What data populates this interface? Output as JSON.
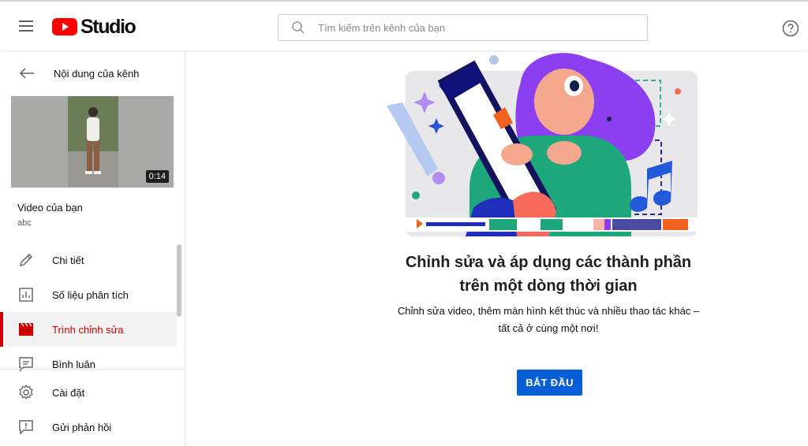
{
  "header": {
    "logo_text": "Studio",
    "search_placeholder": "Tìm kiếm trên kênh của bạn",
    "brand_color": "#ff0000"
  },
  "sidebar": {
    "back_label": "Nội dung của kênh",
    "video": {
      "duration": "0:14",
      "title": "Video của bạn",
      "subtitle": "abc"
    },
    "nav_items": [
      {
        "label": "Chi tiết",
        "icon": "pencil-icon"
      },
      {
        "label": "Số liệu phân tích",
        "icon": "analytics-icon"
      },
      {
        "label": "Trình chỉnh sửa",
        "icon": "editor-icon",
        "active": true
      },
      {
        "label": "Bình luận",
        "icon": "comments-icon"
      }
    ],
    "bottom_items": [
      {
        "label": "Cài đặt",
        "icon": "gear-icon"
      },
      {
        "label": "Gửi phản hồi",
        "icon": "feedback-icon"
      }
    ],
    "active_color": "#cc0000"
  },
  "main": {
    "headline_line1": "Chỉnh sửa và áp dụng các thành phần",
    "headline_line2": "trên một dòng thời gian",
    "desc_line1": "Chỉnh sửa video, thêm màn hình kết thúc và nhiều thao tác khác –",
    "desc_line2": "tất cả ở cùng một nơi!",
    "start_button": "BẮT ĐẦU",
    "button_color": "#065fd4"
  }
}
